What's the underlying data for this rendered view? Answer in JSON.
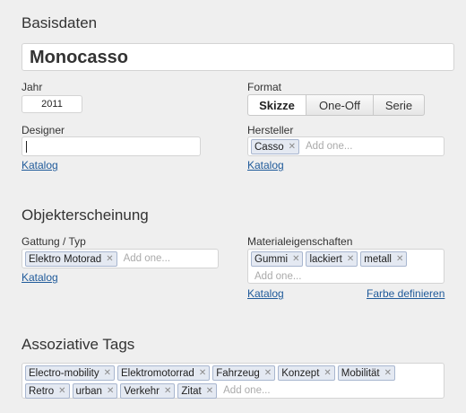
{
  "basis": {
    "title": "Basisdaten",
    "name_value": "Monocasso",
    "jahr_label": "Jahr",
    "jahr_value": "2011",
    "format_label": "Format",
    "format_options": [
      "Skizze",
      "One-Off",
      "Serie"
    ],
    "format_selected": "Skizze",
    "designer_label": "Designer",
    "designer_value": "",
    "designer_link": "Katalog",
    "hersteller_label": "Hersteller",
    "hersteller_tags": [
      "Casso"
    ],
    "hersteller_add": "Add one...",
    "hersteller_link": "Katalog"
  },
  "objekt": {
    "title": "Objekterscheinung",
    "gattung_label": "Gattung / Typ",
    "gattung_tags": [
      "Elektro Motorad"
    ],
    "gattung_add": "Add one...",
    "gattung_link": "Katalog",
    "material_label": "Materialeigenschaften",
    "material_tags": [
      "Gummi",
      "lackiert",
      "metall"
    ],
    "material_add": "Add one...",
    "material_link": "Katalog",
    "farbe_link": "Farbe definieren"
  },
  "assoz": {
    "title": "Assoziative Tags",
    "tags": [
      "Electro-mobility",
      "Elektromotorrad",
      "Fahrzeug",
      "Konzept",
      "Mobilität",
      "Retro",
      "urban",
      "Verkehr",
      "Zitat"
    ],
    "add": "Add one..."
  },
  "icons": {
    "remove": "x-icon"
  }
}
